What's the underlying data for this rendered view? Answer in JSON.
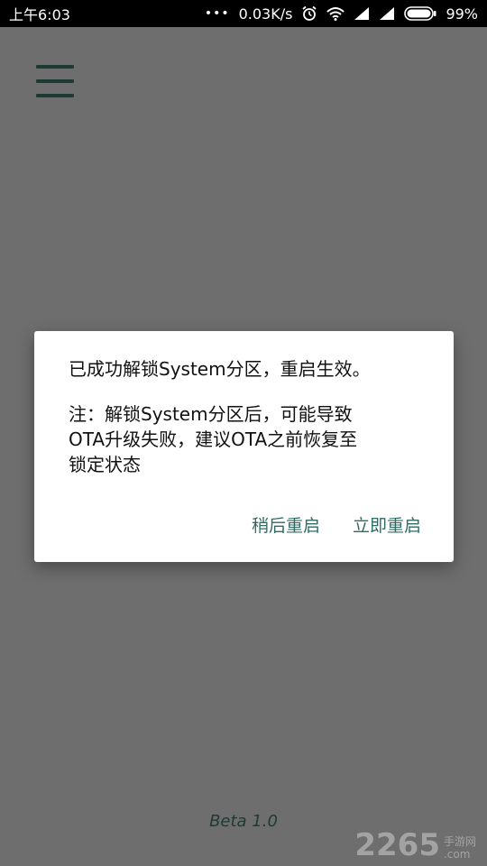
{
  "status_bar": {
    "time": "上午6:03",
    "dots": "•••",
    "network_speed": "0.03K/s",
    "battery": "99%"
  },
  "menu": {
    "icon": "hamburger-menu-icon"
  },
  "dialog": {
    "message": "已成功解锁System分区，重启生效。",
    "note": "注：解锁System分区后，可能导致\nOTA升级失败，建议OTA之前恢复至\n锁定状态",
    "later_button": "稍后重启",
    "restart_button": "立即重启"
  },
  "footer": {
    "version": "Beta 1.0"
  },
  "watermark": {
    "number": "2265",
    "text_top": "手游网",
    "text_bottom": ".com"
  },
  "colors": {
    "overlay_bg": "#6e6e6e",
    "accent": "#2f6a63",
    "dark_teal": "#1f3934"
  }
}
